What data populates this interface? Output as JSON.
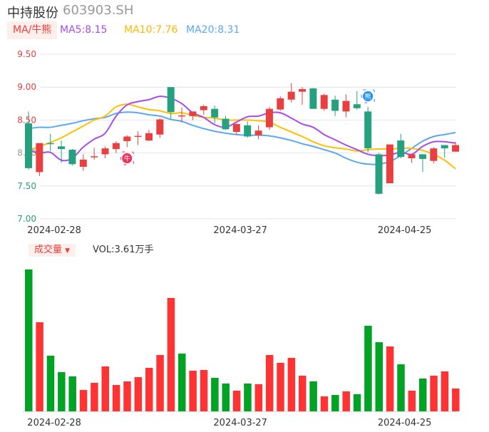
{
  "header": {
    "name": "中持股份",
    "code": "603903.SH"
  },
  "ma_legend": {
    "toggle": "MA/牛熊",
    "ma5": "MA5:8.15",
    "ma10": "MA10:7.76",
    "ma20": "MA20:8.31"
  },
  "volume_legend": {
    "toggle": "成交量",
    "value": "VOL:3.61万手"
  },
  "markers": {
    "bull": "牛",
    "bear": "熊"
  },
  "colors": {
    "up": "#e84040",
    "down": "#26a17f",
    "vol_up": "#ff3333",
    "vol_down": "#00a323",
    "ma5": "#a64cf0",
    "ma10": "#ffc000",
    "ma20": "#5aa7f5",
    "grid": "#e0e4ee"
  },
  "chart_data": [
    {
      "type": "candlestick",
      "title": "中持股份 603903.SH",
      "ylim": [
        7.0,
        9.5
      ],
      "yticks": [
        "9.50",
        "9.00",
        "8.50",
        "8.00",
        "7.50",
        "7.00"
      ],
      "xticks": [
        {
          "index": 3,
          "label": "2024-02-28"
        },
        {
          "index": 20,
          "label": "2024-03-27"
        },
        {
          "index": 35,
          "label": "2024-04-25"
        }
      ],
      "ohlc": [
        [
          8.45,
          8.63,
          7.75,
          7.77
        ],
        [
          7.71,
          8.15,
          7.65,
          8.15
        ],
        [
          8.15,
          8.29,
          8.03,
          8.14
        ],
        [
          8.1,
          8.19,
          7.85,
          8.06
        ],
        [
          8.05,
          8.06,
          7.81,
          7.83
        ],
        [
          7.79,
          7.98,
          7.73,
          7.9
        ],
        [
          7.94,
          8.08,
          7.9,
          7.95
        ],
        [
          7.98,
          8.1,
          7.92,
          8.07
        ],
        [
          8.06,
          8.18,
          8.0,
          8.15
        ],
        [
          8.18,
          8.27,
          8.09,
          8.25
        ],
        [
          8.25,
          8.33,
          8.12,
          8.26
        ],
        [
          8.19,
          8.35,
          8.18,
          8.3
        ],
        [
          8.28,
          8.53,
          8.23,
          8.51
        ],
        [
          9.0,
          9.0,
          8.52,
          8.62
        ],
        [
          8.56,
          8.69,
          8.47,
          8.57
        ],
        [
          8.56,
          8.63,
          8.5,
          8.63
        ],
        [
          8.65,
          8.73,
          8.58,
          8.71
        ],
        [
          8.67,
          8.72,
          8.45,
          8.54
        ],
        [
          8.52,
          8.56,
          8.35,
          8.36
        ],
        [
          8.32,
          8.45,
          8.28,
          8.44
        ],
        [
          8.42,
          8.48,
          8.23,
          8.25
        ],
        [
          8.27,
          8.42,
          8.21,
          8.34
        ],
        [
          8.39,
          8.7,
          8.35,
          8.67
        ],
        [
          8.66,
          8.86,
          8.64,
          8.83
        ],
        [
          8.81,
          9.06,
          8.77,
          8.93
        ],
        [
          8.93,
          9.0,
          8.73,
          8.97
        ],
        [
          8.98,
          8.99,
          8.67,
          8.67
        ],
        [
          8.67,
          8.9,
          8.64,
          8.88
        ],
        [
          8.81,
          8.87,
          8.56,
          8.64
        ],
        [
          8.63,
          8.89,
          8.54,
          8.79
        ],
        [
          8.74,
          8.94,
          8.66,
          8.68
        ],
        [
          8.63,
          8.7,
          8.01,
          8.07
        ],
        [
          7.98,
          8.0,
          7.37,
          7.38
        ],
        [
          7.54,
          8.13,
          7.54,
          8.13
        ],
        [
          8.19,
          8.29,
          7.92,
          7.94
        ],
        [
          7.92,
          7.98,
          7.85,
          7.98
        ],
        [
          7.98,
          7.98,
          7.71,
          7.91
        ],
        [
          7.88,
          8.09,
          7.84,
          8.07
        ],
        [
          8.12,
          8.12,
          7.93,
          8.07
        ],
        [
          8.02,
          8.17,
          8.02,
          8.12
        ]
      ],
      "series": [
        {
          "name": "MA5",
          "values": [
            8.04,
            8.0,
            8.01,
            7.89,
            7.92,
            8.09,
            8.21,
            8.3,
            8.56,
            8.73,
            8.78,
            8.81,
            8.86,
            8.83,
            8.75,
            8.61,
            8.54,
            8.43,
            8.39,
            8.47,
            8.55,
            8.56,
            8.61,
            8.61,
            8.53,
            8.44,
            8.39,
            8.28,
            8.2,
            8.12,
            8.05,
            7.98,
            7.96,
            7.97,
            8.01,
            7.98,
            8.1,
            8.17,
            8.17,
            8.15
          ]
        },
        {
          "name": "MA10",
          "values": [
            8.04,
            8.1,
            8.16,
            8.23,
            8.32,
            8.41,
            8.5,
            8.56,
            8.7,
            8.74,
            8.7,
            8.66,
            8.64,
            8.6,
            8.61,
            8.57,
            8.54,
            8.53,
            8.5,
            8.5,
            8.5,
            8.49,
            8.47,
            8.39,
            8.32,
            8.25,
            8.17,
            8.11,
            8.08,
            8.06,
            8.03,
            8.05,
            8.06,
            8.06,
            8.07,
            8.07,
            8.04,
            7.98,
            7.89,
            7.76
          ]
        },
        {
          "name": "MA20",
          "values": [
            8.37,
            8.39,
            8.39,
            8.42,
            8.45,
            8.49,
            8.52,
            8.54,
            8.6,
            8.62,
            8.61,
            8.58,
            8.56,
            8.51,
            8.48,
            8.42,
            8.37,
            8.33,
            8.3,
            8.28,
            8.27,
            8.27,
            8.26,
            8.23,
            8.19,
            8.14,
            8.1,
            8.05,
            8.0,
            7.92,
            7.86,
            7.83,
            7.83,
            7.87,
            7.96,
            8.07,
            8.18,
            8.25,
            8.28,
            8.31
          ]
        }
      ],
      "marker_indices": {
        "bull": 9,
        "bear": 31
      }
    },
    {
      "type": "bar",
      "title": "成交量",
      "unit": "万手",
      "values": [
        22.45,
        14.1,
        8.8,
        6.2,
        5.53,
        3.38,
        4.51,
        7.11,
        4.17,
        4.74,
        5.41,
        6.88,
        8.91,
        17.94,
        9.14,
        6.43,
        6.54,
        5.3,
        4.4,
        3.27,
        4.4,
        4.29,
        8.91,
        7.67,
        8.46,
        5.64,
        4.74,
        2.37,
        2.59,
        3.16,
        2.71,
        13.54,
        10.94,
        10.27,
        7.44,
        3.27,
        5.19,
        5.64,
        6.32,
        3.61
      ],
      "up": [
        0,
        1,
        0,
        0,
        0,
        1,
        1,
        1,
        1,
        1,
        1,
        1,
        1,
        1,
        0,
        1,
        1,
        0,
        0,
        1,
        0,
        1,
        1,
        1,
        1,
        1,
        0,
        1,
        0,
        1,
        0,
        0,
        0,
        1,
        0,
        1,
        0,
        1,
        1,
        1
      ],
      "xticks": [
        "2024-02-28",
        "2024-03-27",
        "2024-04-25"
      ]
    }
  ]
}
